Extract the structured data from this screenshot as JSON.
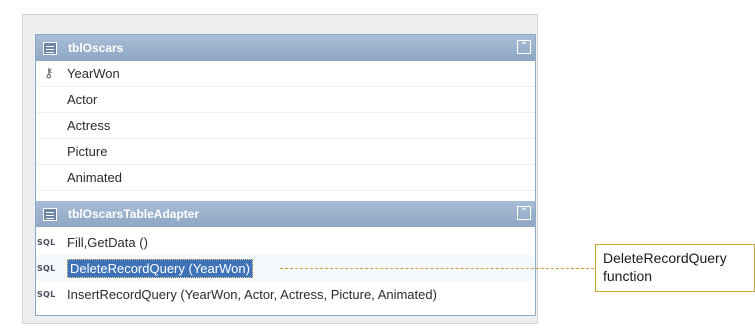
{
  "table": {
    "title": "tblOscars",
    "columns": [
      "YearWon",
      "Actor",
      "Actress",
      "Picture",
      "Animated"
    ]
  },
  "adapter": {
    "title": "tblOscarsTableAdapter",
    "queries": [
      "Fill,GetData ()",
      "DeleteRecordQuery (YearWon)",
      "InsertRecordQuery (YearWon, Actor, Actress, Picture, Animated)"
    ],
    "selected_index": 1,
    "query_icon_label": "SQL"
  },
  "callout": {
    "line1": "DeleteRecordQuery",
    "line2": "function"
  },
  "colors": {
    "selection": "#3f73b8",
    "callout_border": "#c9a238",
    "header": "#8fa7c4"
  }
}
